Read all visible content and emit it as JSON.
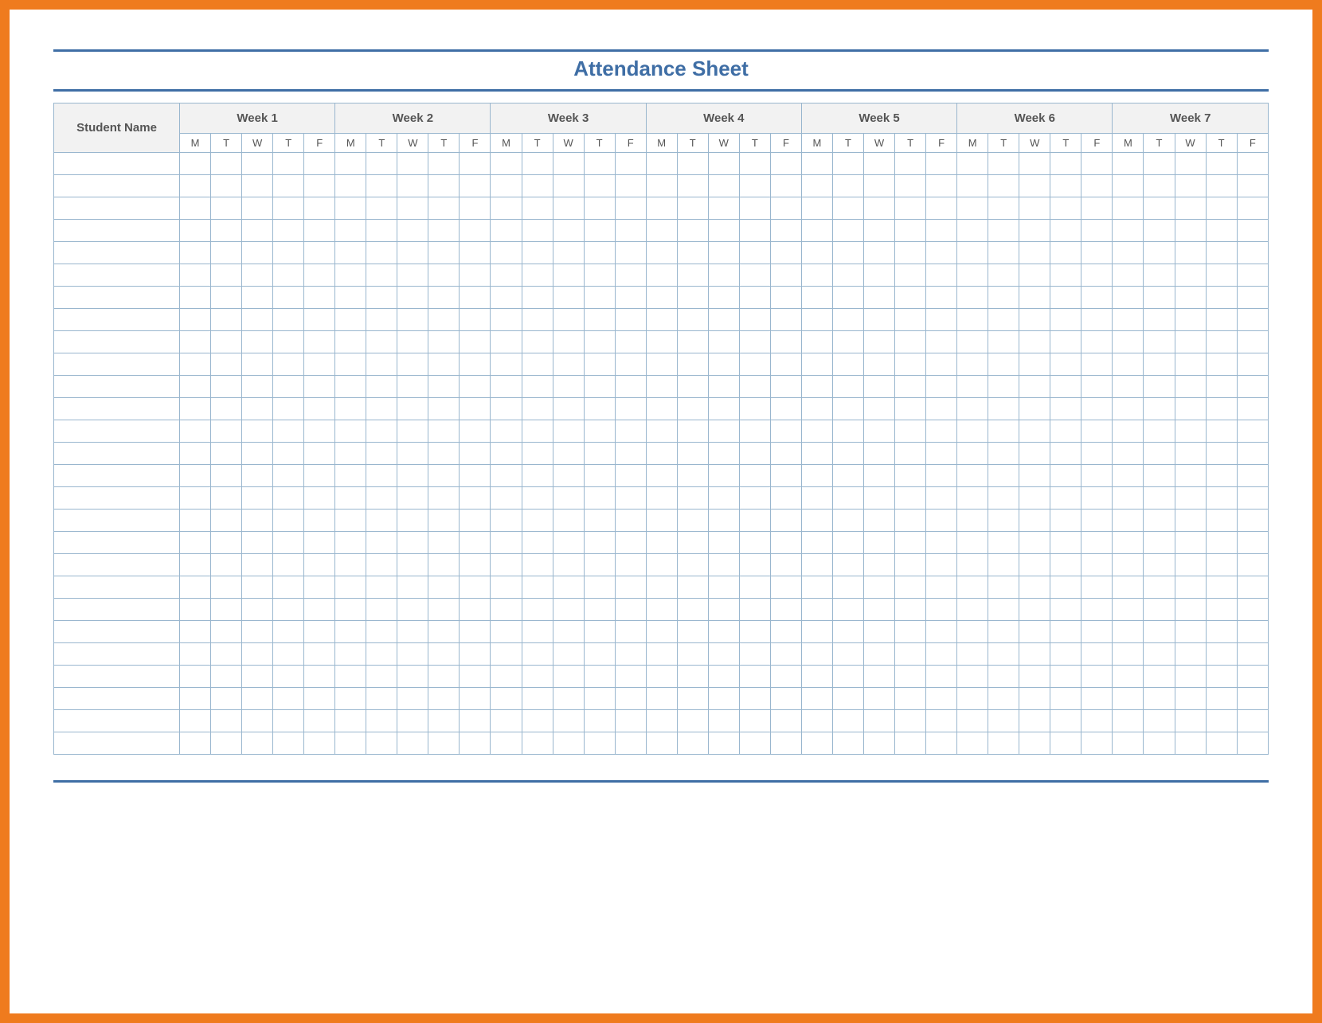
{
  "title": "Attendance Sheet",
  "columns": {
    "name_label": "Student Name",
    "weeks": [
      "Week 1",
      "Week 2",
      "Week 3",
      "Week 4",
      "Week 5",
      "Week 6",
      "Week 7"
    ],
    "days": [
      "M",
      "T",
      "W",
      "T",
      "F"
    ]
  },
  "row_count": 27
}
